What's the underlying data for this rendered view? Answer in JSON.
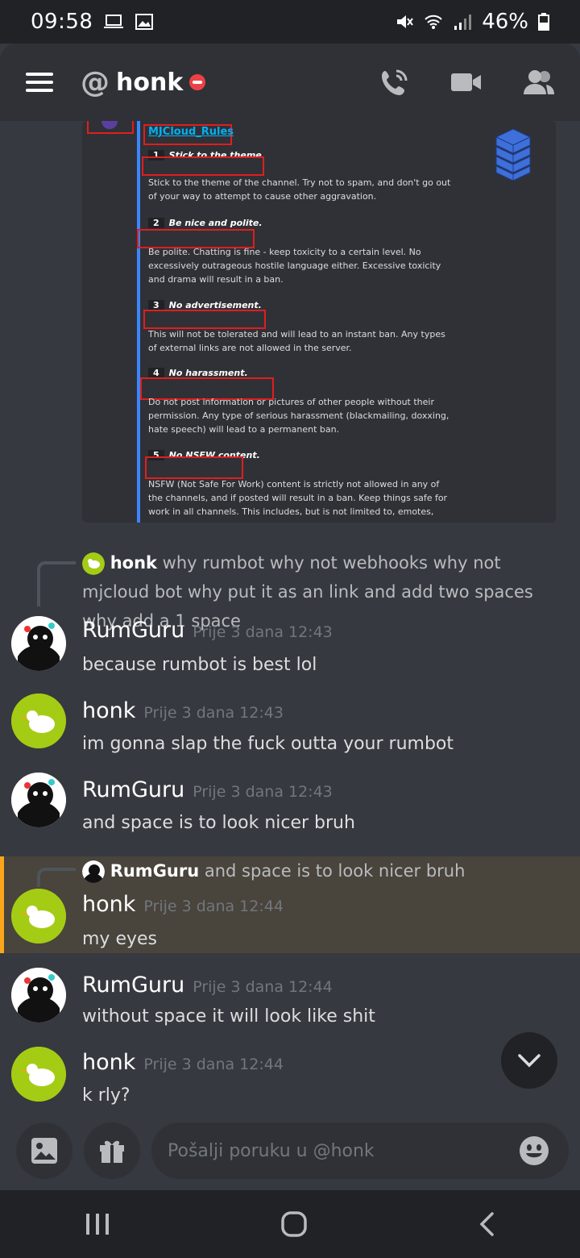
{
  "status_bar": {
    "time": "09:58",
    "battery": "46%"
  },
  "header": {
    "title": "honk",
    "at_symbol": "@"
  },
  "embed": {
    "title": "MJCloud_Rules",
    "rules": [
      {
        "num": "1",
        "head": "Stick to the theme.",
        "body": "Stick to the theme of the channel. Try not to spam, and don't go out of your way to attempt to cause other aggravation."
      },
      {
        "num": "2",
        "head": "Be nice and polite.",
        "body": "Be polite. Chatting is fine - keep toxicity to a certain level. No excessively outrageous hostile language either. Excessive toxicity and drama will result in a ban."
      },
      {
        "num": "3",
        "head": "No advertisement.",
        "body": "This will not be tolerated and will lead to an instant ban. Any types of external links are not allowed in the server."
      },
      {
        "num": "4",
        "head": "No harassment.",
        "body": "Do not post information or pictures of other people without their permission. Any type of serious harassment (blackmailing, doxxing, hate speech) will lead to a permanent ban."
      },
      {
        "num": "5",
        "head": "No NSFW content.",
        "body": "NSFW (Not Safe For Work) content is strictly not allowed in any of the channels, and if posted will result in a ban. Keep things safe for work in all channels. This includes, but is not limited to, emotes,"
      }
    ]
  },
  "reply1": {
    "name": "honk",
    "text": "why rumbot why not webhooks why not mjcloud bot why put it as an link and add two spaces why add a 1 space"
  },
  "messages": [
    {
      "name": "RumGuru",
      "time": "Prije 3 dana 12:43",
      "text": "because rumbot is best lol"
    },
    {
      "name": "honk",
      "time": "Prije 3 dana 12:43",
      "text": "im gonna slap the fuck outta your rumbot"
    },
    {
      "name": "RumGuru",
      "time": "Prije 3 dana 12:43",
      "text": "and space is to look nicer bruh"
    },
    {
      "name": "honk",
      "time": "Prije 3 dana 12:44",
      "text": "my eyes"
    },
    {
      "name": "RumGuru",
      "time": "Prije 3 dana 12:44",
      "text": "without space it will look like shit"
    },
    {
      "name": "honk",
      "time": "Prije 3 dana 12:44",
      "text": "k rly?"
    }
  ],
  "reply2": {
    "name": "RumGuru",
    "text": "and space is to look nicer bruh"
  },
  "composer": {
    "placeholder": "Pošalji poruku u @honk"
  },
  "colors": {
    "accent": "#faa61a",
    "dnd": "#ed4245",
    "link": "#00b0f4",
    "honk_avatar": "#a5cc14"
  }
}
